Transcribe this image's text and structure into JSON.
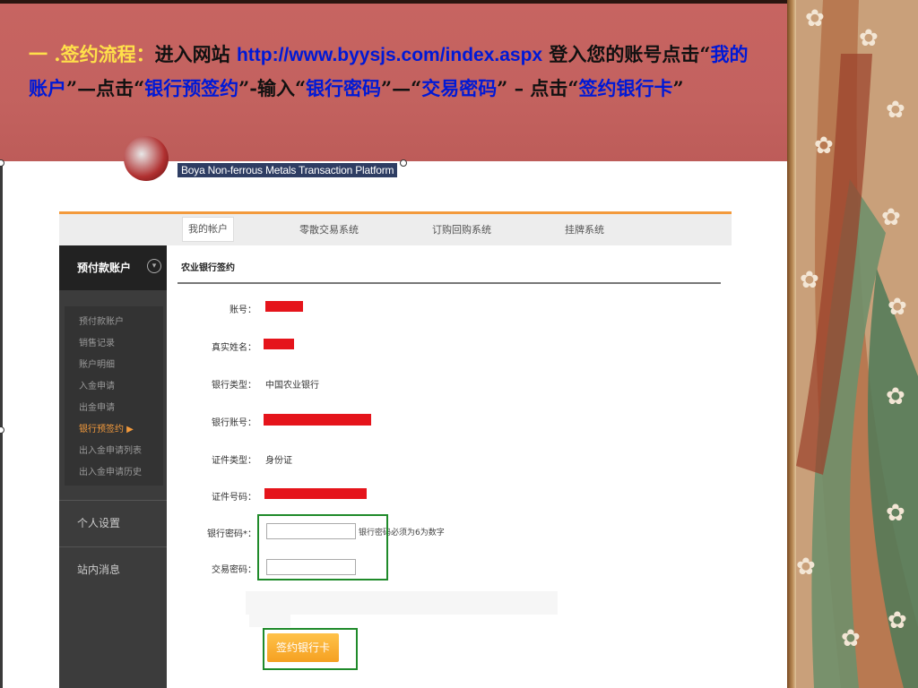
{
  "slide": {
    "prefix": "一 .签约流程：",
    "t1": "进入网站 ",
    "url": "http://www.byysjs.com/index.aspx",
    "t2": " 登入您的账号点击“",
    "k1": "我的账户",
    "t3": "”—点击“",
    "k2": "银行预签约",
    "t4": "”-输入“",
    "k3": "银行密码",
    "t5": "”—“",
    "k4": "交易密码",
    "t6": "” – 点击“",
    "k5": "签约银行卡",
    "t7": "”"
  },
  "site": {
    "logo_subtitle": "Boya Non-ferrous Metals Transaction Platform"
  },
  "nav": [
    "我的帐户",
    "零散交易系统",
    "订购回购系统",
    "挂牌系统"
  ],
  "sidebar": {
    "header": "预付款账户",
    "submenu": [
      "预付款账户",
      "销售记录",
      "账户明细",
      "入金申请",
      "出金申请",
      "银行预签约 ▶",
      "出入金申请列表",
      "出入金申请历史"
    ],
    "active_index": 5,
    "sections": [
      "个人设置",
      "站内消息"
    ]
  },
  "form": {
    "title": "农业银行签约",
    "account_label": "账号：",
    "name_label": "真实姓名：",
    "bank_type_label": "银行类型：",
    "bank_type_value": "中国农业银行",
    "bank_account_label": "银行账号：",
    "id_type_label": "证件类型：",
    "id_type_value": "身份证",
    "id_number_label": "证件号码：",
    "bank_password_label": "银行密码*：",
    "bank_password_hint": "银行密码必须为6为数字",
    "trade_password_label": "交易密码：",
    "submit_label": "签约银行卡"
  },
  "colors": {
    "header_bg": "#c3625f",
    "highlight_yellow": "#ffe04a",
    "highlight_blue": "#0019d6",
    "redaction": "#e5141b",
    "annotation_green": "#1f8a2a",
    "button_orange": "#f5a021"
  }
}
